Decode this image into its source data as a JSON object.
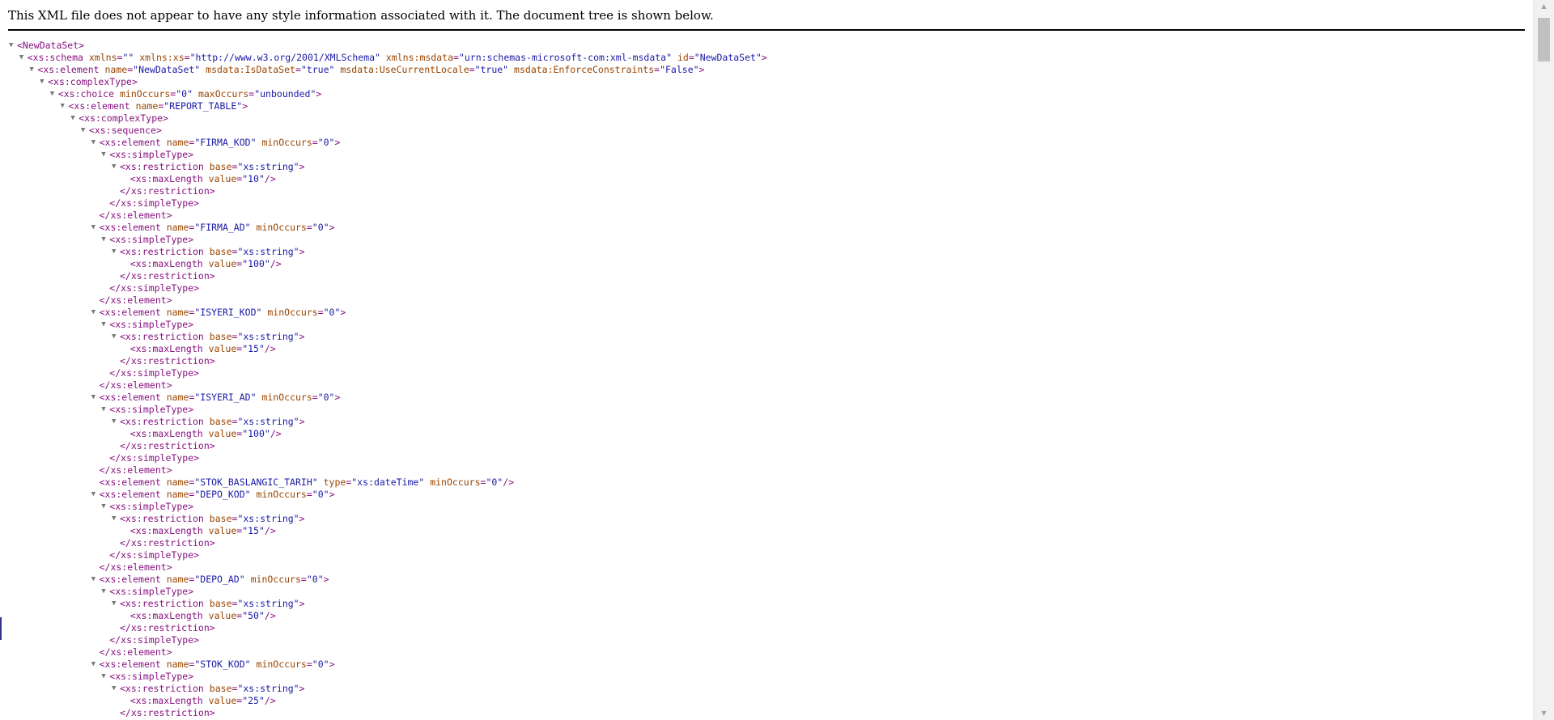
{
  "header": {
    "message": "This XML file does not appear to have any style information associated with it. The document tree is shown below."
  },
  "lines": [
    {
      "d": 0,
      "t": true,
      "k": "open",
      "tag": "NewDataSet",
      "attrs": []
    },
    {
      "d": 1,
      "t": true,
      "k": "open",
      "tag": "xs:schema",
      "attrs": [
        [
          "xmlns",
          ""
        ],
        [
          "xmlns:xs",
          "http://www.w3.org/2001/XMLSchema"
        ],
        [
          "xmlns:msdata",
          "urn:schemas-microsoft-com:xml-msdata"
        ],
        [
          "id",
          "NewDataSet"
        ]
      ]
    },
    {
      "d": 2,
      "t": true,
      "k": "open",
      "tag": "xs:element",
      "attrs": [
        [
          "name",
          "NewDataSet"
        ],
        [
          "msdata:IsDataSet",
          "true"
        ],
        [
          "msdata:UseCurrentLocale",
          "true"
        ],
        [
          "msdata:EnforceConstraints",
          "False"
        ]
      ]
    },
    {
      "d": 3,
      "t": true,
      "k": "open",
      "tag": "xs:complexType",
      "attrs": []
    },
    {
      "d": 4,
      "t": true,
      "k": "open",
      "tag": "xs:choice",
      "attrs": [
        [
          "minOccurs",
          "0"
        ],
        [
          "maxOccurs",
          "unbounded"
        ]
      ]
    },
    {
      "d": 5,
      "t": true,
      "k": "open",
      "tag": "xs:element",
      "attrs": [
        [
          "name",
          "REPORT_TABLE"
        ]
      ]
    },
    {
      "d": 6,
      "t": true,
      "k": "open",
      "tag": "xs:complexType",
      "attrs": []
    },
    {
      "d": 7,
      "t": true,
      "k": "open",
      "tag": "xs:sequence",
      "attrs": []
    },
    {
      "d": 8,
      "t": true,
      "k": "open",
      "tag": "xs:element",
      "attrs": [
        [
          "name",
          "FIRMA_KOD"
        ],
        [
          "minOccurs",
          "0"
        ]
      ]
    },
    {
      "d": 9,
      "t": true,
      "k": "open",
      "tag": "xs:simpleType",
      "attrs": []
    },
    {
      "d": 10,
      "t": true,
      "k": "open",
      "tag": "xs:restriction",
      "attrs": [
        [
          "base",
          "xs:string"
        ]
      ]
    },
    {
      "d": 11,
      "t": false,
      "k": "self",
      "tag": "xs:maxLength",
      "attrs": [
        [
          "value",
          "10"
        ]
      ]
    },
    {
      "d": 10,
      "t": false,
      "k": "close",
      "tag": "xs:restriction",
      "attrs": []
    },
    {
      "d": 9,
      "t": false,
      "k": "close",
      "tag": "xs:simpleType",
      "attrs": []
    },
    {
      "d": 8,
      "t": false,
      "k": "close",
      "tag": "xs:element",
      "attrs": []
    },
    {
      "d": 8,
      "t": true,
      "k": "open",
      "tag": "xs:element",
      "attrs": [
        [
          "name",
          "FIRMA_AD"
        ],
        [
          "minOccurs",
          "0"
        ]
      ]
    },
    {
      "d": 9,
      "t": true,
      "k": "open",
      "tag": "xs:simpleType",
      "attrs": []
    },
    {
      "d": 10,
      "t": true,
      "k": "open",
      "tag": "xs:restriction",
      "attrs": [
        [
          "base",
          "xs:string"
        ]
      ]
    },
    {
      "d": 11,
      "t": false,
      "k": "self",
      "tag": "xs:maxLength",
      "attrs": [
        [
          "value",
          "100"
        ]
      ]
    },
    {
      "d": 10,
      "t": false,
      "k": "close",
      "tag": "xs:restriction",
      "attrs": []
    },
    {
      "d": 9,
      "t": false,
      "k": "close",
      "tag": "xs:simpleType",
      "attrs": []
    },
    {
      "d": 8,
      "t": false,
      "k": "close",
      "tag": "xs:element",
      "attrs": []
    },
    {
      "d": 8,
      "t": true,
      "k": "open",
      "tag": "xs:element",
      "attrs": [
        [
          "name",
          "ISYERI_KOD"
        ],
        [
          "minOccurs",
          "0"
        ]
      ]
    },
    {
      "d": 9,
      "t": true,
      "k": "open",
      "tag": "xs:simpleType",
      "attrs": []
    },
    {
      "d": 10,
      "t": true,
      "k": "open",
      "tag": "xs:restriction",
      "attrs": [
        [
          "base",
          "xs:string"
        ]
      ]
    },
    {
      "d": 11,
      "t": false,
      "k": "self",
      "tag": "xs:maxLength",
      "attrs": [
        [
          "value",
          "15"
        ]
      ]
    },
    {
      "d": 10,
      "t": false,
      "k": "close",
      "tag": "xs:restriction",
      "attrs": []
    },
    {
      "d": 9,
      "t": false,
      "k": "close",
      "tag": "xs:simpleType",
      "attrs": []
    },
    {
      "d": 8,
      "t": false,
      "k": "close",
      "tag": "xs:element",
      "attrs": []
    },
    {
      "d": 8,
      "t": true,
      "k": "open",
      "tag": "xs:element",
      "attrs": [
        [
          "name",
          "ISYERI_AD"
        ],
        [
          "minOccurs",
          "0"
        ]
      ]
    },
    {
      "d": 9,
      "t": true,
      "k": "open",
      "tag": "xs:simpleType",
      "attrs": []
    },
    {
      "d": 10,
      "t": true,
      "k": "open",
      "tag": "xs:restriction",
      "attrs": [
        [
          "base",
          "xs:string"
        ]
      ]
    },
    {
      "d": 11,
      "t": false,
      "k": "self",
      "tag": "xs:maxLength",
      "attrs": [
        [
          "value",
          "100"
        ]
      ]
    },
    {
      "d": 10,
      "t": false,
      "k": "close",
      "tag": "xs:restriction",
      "attrs": []
    },
    {
      "d": 9,
      "t": false,
      "k": "close",
      "tag": "xs:simpleType",
      "attrs": []
    },
    {
      "d": 8,
      "t": false,
      "k": "close",
      "tag": "xs:element",
      "attrs": []
    },
    {
      "d": 8,
      "t": false,
      "k": "self",
      "tag": "xs:element",
      "attrs": [
        [
          "name",
          "STOK_BASLANGIC_TARIH"
        ],
        [
          "type",
          "xs:dateTime"
        ],
        [
          "minOccurs",
          "0"
        ]
      ]
    },
    {
      "d": 8,
      "t": true,
      "k": "open",
      "tag": "xs:element",
      "attrs": [
        [
          "name",
          "DEPO_KOD"
        ],
        [
          "minOccurs",
          "0"
        ]
      ]
    },
    {
      "d": 9,
      "t": true,
      "k": "open",
      "tag": "xs:simpleType",
      "attrs": []
    },
    {
      "d": 10,
      "t": true,
      "k": "open",
      "tag": "xs:restriction",
      "attrs": [
        [
          "base",
          "xs:string"
        ]
      ]
    },
    {
      "d": 11,
      "t": false,
      "k": "self",
      "tag": "xs:maxLength",
      "attrs": [
        [
          "value",
          "15"
        ]
      ]
    },
    {
      "d": 10,
      "t": false,
      "k": "close",
      "tag": "xs:restriction",
      "attrs": []
    },
    {
      "d": 9,
      "t": false,
      "k": "close",
      "tag": "xs:simpleType",
      "attrs": []
    },
    {
      "d": 8,
      "t": false,
      "k": "close",
      "tag": "xs:element",
      "attrs": []
    },
    {
      "d": 8,
      "t": true,
      "k": "open",
      "tag": "xs:element",
      "attrs": [
        [
          "name",
          "DEPO_AD"
        ],
        [
          "minOccurs",
          "0"
        ]
      ]
    },
    {
      "d": 9,
      "t": true,
      "k": "open",
      "tag": "xs:simpleType",
      "attrs": []
    },
    {
      "d": 10,
      "t": true,
      "k": "open",
      "tag": "xs:restriction",
      "attrs": [
        [
          "base",
          "xs:string"
        ]
      ]
    },
    {
      "d": 11,
      "t": false,
      "k": "self",
      "tag": "xs:maxLength",
      "attrs": [
        [
          "value",
          "50"
        ]
      ]
    },
    {
      "d": 10,
      "t": false,
      "k": "close",
      "tag": "xs:restriction",
      "attrs": []
    },
    {
      "d": 9,
      "t": false,
      "k": "close",
      "tag": "xs:simpleType",
      "attrs": []
    },
    {
      "d": 8,
      "t": false,
      "k": "close",
      "tag": "xs:element",
      "attrs": []
    },
    {
      "d": 8,
      "t": true,
      "k": "open",
      "tag": "xs:element",
      "attrs": [
        [
          "name",
          "STOK_KOD"
        ],
        [
          "minOccurs",
          "0"
        ]
      ]
    },
    {
      "d": 9,
      "t": true,
      "k": "open",
      "tag": "xs:simpleType",
      "attrs": []
    },
    {
      "d": 10,
      "t": true,
      "k": "open",
      "tag": "xs:restriction",
      "attrs": [
        [
          "base",
          "xs:string"
        ]
      ]
    },
    {
      "d": 11,
      "t": false,
      "k": "self",
      "tag": "xs:maxLength",
      "attrs": [
        [
          "value",
          "25"
        ]
      ]
    },
    {
      "d": 10,
      "t": false,
      "k": "close",
      "tag": "xs:restriction",
      "attrs": []
    }
  ]
}
